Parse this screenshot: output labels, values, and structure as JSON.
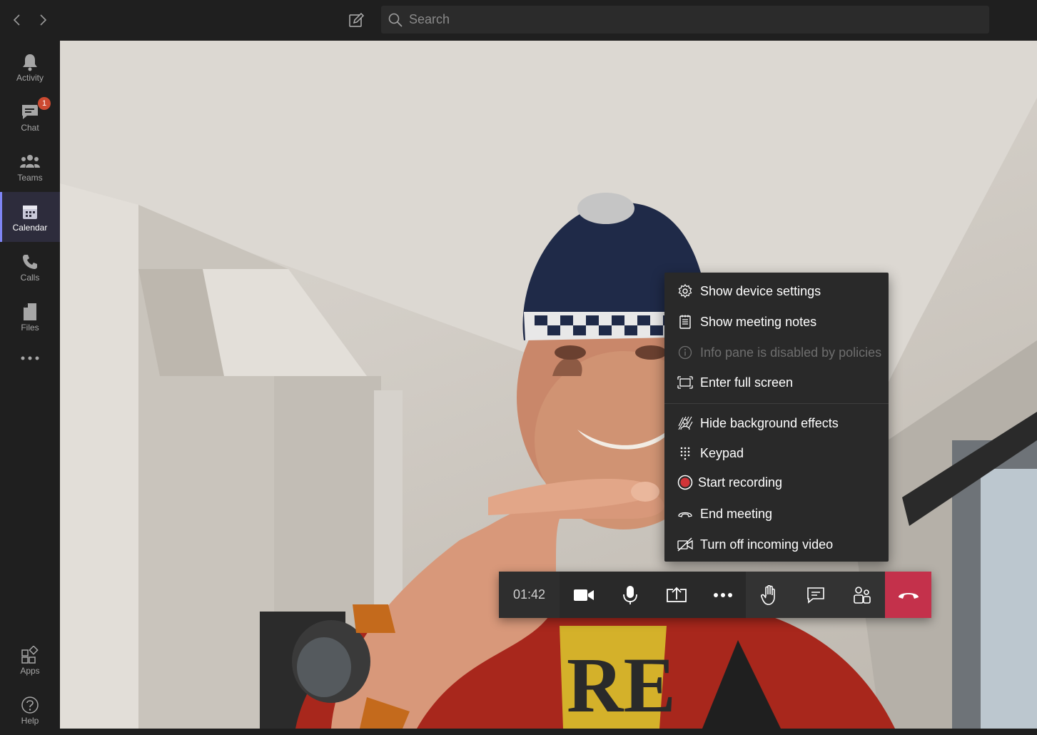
{
  "topbar": {
    "back_icon": "chevron-left-icon",
    "forward_icon": "chevron-right-icon",
    "compose_icon": "compose-icon",
    "search": {
      "placeholder": "Search",
      "icon": "search-icon"
    }
  },
  "rail": {
    "items": [
      {
        "label": "Activity",
        "icon": "bell-icon",
        "active": false
      },
      {
        "label": "Chat",
        "icon": "chat-icon",
        "active": false,
        "badge": "1"
      },
      {
        "label": "Teams",
        "icon": "teams-icon",
        "active": false
      },
      {
        "label": "Calendar",
        "icon": "calendar-icon",
        "active": true
      },
      {
        "label": "Calls",
        "icon": "phone-icon",
        "active": false
      },
      {
        "label": "Files",
        "icon": "file-icon",
        "active": false
      }
    ],
    "more_icon": "more-icon",
    "bottom_items": [
      {
        "label": "Apps",
        "icon": "apps-icon"
      },
      {
        "label": "Help",
        "icon": "help-icon"
      }
    ]
  },
  "menu": {
    "items": [
      {
        "label": "Show device settings",
        "icon": "gear-icon",
        "disabled": false
      },
      {
        "label": "Show meeting notes",
        "icon": "notes-icon",
        "disabled": false
      },
      {
        "label": "Info pane is disabled by policies",
        "icon": "info-icon",
        "disabled": true
      },
      {
        "label": "Enter full screen",
        "icon": "fullscreen-icon",
        "disabled": false
      },
      {
        "label": "Hide background effects",
        "icon": "background-effects-icon",
        "disabled": false
      },
      {
        "label": "Keypad",
        "icon": "keypad-icon",
        "disabled": false
      },
      {
        "label": "Start recording",
        "icon": "record-icon",
        "disabled": false
      },
      {
        "label": "End meeting",
        "icon": "end-meeting-icon",
        "disabled": false
      },
      {
        "label": "Turn off incoming video",
        "icon": "video-off-icon",
        "disabled": false
      }
    ]
  },
  "callbar": {
    "timer": "01:42",
    "buttons": [
      {
        "name": "camera",
        "icon": "camera-icon"
      },
      {
        "name": "mic",
        "icon": "microphone-icon"
      },
      {
        "name": "share",
        "icon": "share-screen-icon"
      },
      {
        "name": "more",
        "icon": "more-actions-icon"
      },
      {
        "name": "raise-hand",
        "icon": "raise-hand-icon"
      },
      {
        "name": "chat",
        "icon": "meeting-chat-icon"
      },
      {
        "name": "participants",
        "icon": "participants-icon"
      },
      {
        "name": "hang-up",
        "icon": "hang-up-icon"
      }
    ]
  },
  "colors": {
    "hangup": "#c4314b",
    "badge": "#cc4a31",
    "active_rail": "#7f85f5"
  }
}
